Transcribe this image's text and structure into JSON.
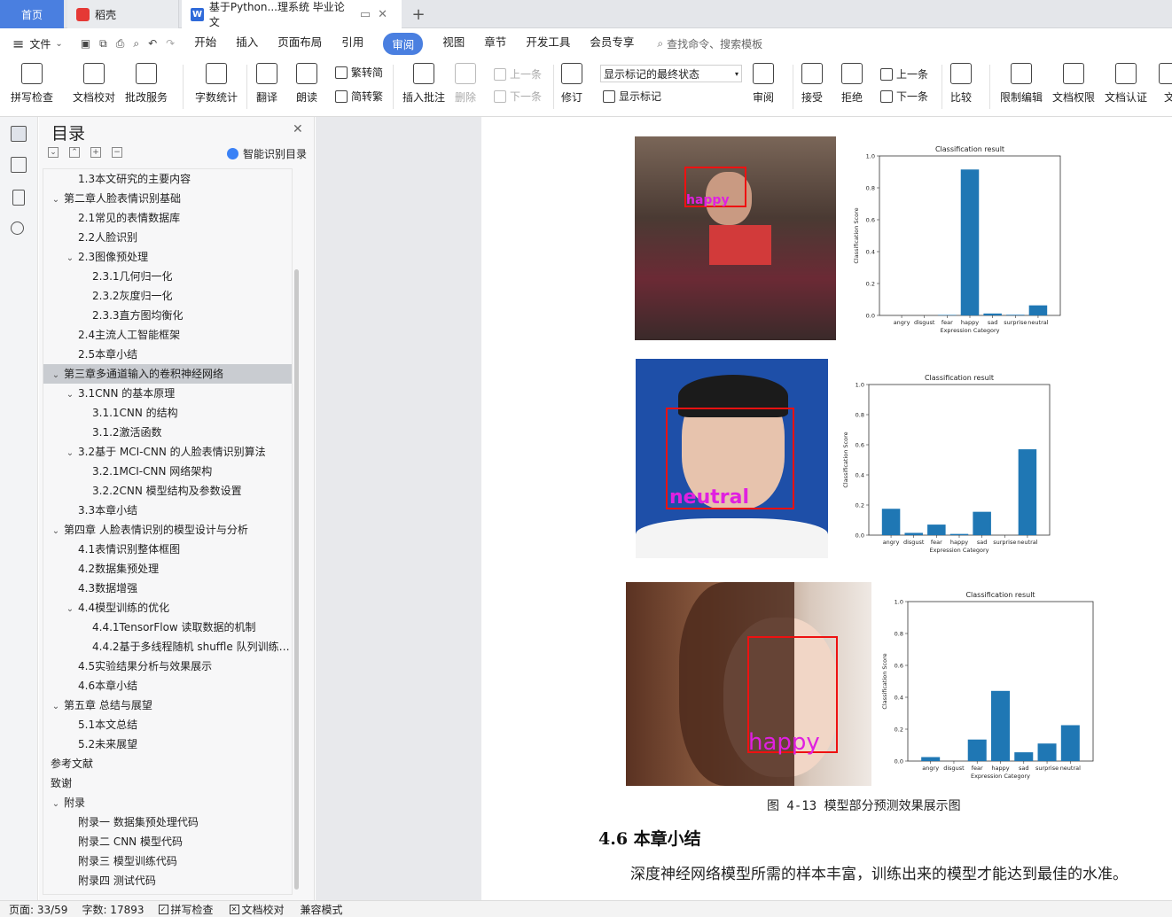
{
  "tabs": {
    "home": "首页",
    "daoke": "稻壳",
    "doc": "基于Python...理系统 毕业论文",
    "plus": "+"
  },
  "menubar": {
    "hamburger": "≡",
    "file": "文件",
    "items": [
      "开始",
      "插入",
      "页面布局",
      "引用",
      "审阅",
      "视图",
      "章节",
      "开发工具",
      "会员专享"
    ],
    "active": "审阅",
    "search": "查找命令、搜索模板"
  },
  "ribbon": {
    "spell": "拼写检查",
    "proof": "文档校对",
    "annot_service": "批改服务",
    "wordcount": "字数统计",
    "translate": "翻译",
    "read": "朗读",
    "to_trad": "简转繁",
    "to_simp": "繁转简",
    "insert_comment": "插入批注",
    "delete": "删除",
    "prev_c": "上一条",
    "next_c": "下一条",
    "revise": "修订",
    "markup_mode": "显示标记的最终状态",
    "show_markup": "显示标记",
    "review": "审阅",
    "accept": "接受",
    "reject": "拒绝",
    "prev": "上一条",
    "next": "下一条",
    "compare": "比较",
    "restrict": "限制编辑",
    "perm": "文档权限",
    "cert": "文档认证",
    "more": "文"
  },
  "toc": {
    "title": "目录",
    "smart": "智能识别目录",
    "items": [
      {
        "level": 2,
        "text": "1.3本文研究的主要内容"
      },
      {
        "level": 1,
        "text": "第二章人脸表情识别基础",
        "toggle": "⌄"
      },
      {
        "level": 2,
        "text": "2.1常见的表情数据库"
      },
      {
        "level": 2,
        "text": "2.2人脸识别"
      },
      {
        "level": 2,
        "text": "2.3图像预处理",
        "toggle": "⌄"
      },
      {
        "level": 3,
        "text": "2.3.1几何归一化"
      },
      {
        "level": 3,
        "text": "2.3.2灰度归一化"
      },
      {
        "level": 3,
        "text": "2.3.3直方图均衡化"
      },
      {
        "level": 2,
        "text": "2.4主流人工智能框架"
      },
      {
        "level": 2,
        "text": "2.5本章小结"
      },
      {
        "level": 1,
        "text": "第三章多通道输入的卷积神经网络",
        "toggle": "⌄",
        "selected": true
      },
      {
        "level": 2,
        "text": "3.1CNN 的基本原理",
        "toggle": "⌄"
      },
      {
        "level": 3,
        "text": "3.1.1CNN 的结构"
      },
      {
        "level": 3,
        "text": "3.1.2激活函数"
      },
      {
        "level": 2,
        "text": "3.2基于 MCI-CNN 的人脸表情识别算法",
        "toggle": "⌄"
      },
      {
        "level": 3,
        "text": "3.2.1MCI-CNN 网络架构"
      },
      {
        "level": 3,
        "text": "3.2.2CNN 模型结构及参数设置"
      },
      {
        "level": 2,
        "text": "3.3本章小结"
      },
      {
        "level": 1,
        "text": "第四章  人脸表情识别的模型设计与分析",
        "toggle": "⌄"
      },
      {
        "level": 2,
        "text": "4.1表情识别整体框图"
      },
      {
        "level": 2,
        "text": "4.2数据集预处理"
      },
      {
        "level": 2,
        "text": "4.3数据增强"
      },
      {
        "level": 2,
        "text": "4.4模型训练的优化",
        "toggle": "⌄"
      },
      {
        "level": 3,
        "text": "4.4.1TensorFlow 读取数据的机制"
      },
      {
        "level": 3,
        "text": "4.4.2基于多线程随机 shuffle 队列训练…"
      },
      {
        "level": 2,
        "text": "4.5实验结果分析与效果展示"
      },
      {
        "level": 2,
        "text": "4.6本章小结"
      },
      {
        "level": 1,
        "text": "第五章  总结与展望",
        "toggle": "⌄"
      },
      {
        "level": 2,
        "text": "5.1本文总结"
      },
      {
        "level": 2,
        "text": "5.2未来展望"
      },
      {
        "level": 1,
        "text": "参考文献"
      },
      {
        "level": 1,
        "text": "致谢"
      },
      {
        "level": 1,
        "text": "附录",
        "toggle": "⌄"
      },
      {
        "level": 2,
        "text": "附录一  数据集预处理代码"
      },
      {
        "level": 2,
        "text": "附录二  CNN 模型代码"
      },
      {
        "level": 2,
        "text": "附录三  模型训练代码"
      },
      {
        "level": 2,
        "text": "附录四  测试代码"
      }
    ]
  },
  "document": {
    "photo_labels": [
      "happy",
      "neutral",
      "happy"
    ],
    "caption": "图 4-13 模型部分预测效果展示图",
    "heading": "4.6 本章小结",
    "paragraph": "深度神经网络模型所需的样本丰富，训练出来的模型才能达到最佳的水准。"
  },
  "chart_data": [
    {
      "type": "bar",
      "title": "Classification result",
      "xlabel": "Expression Category",
      "ylabel": "Classification Score",
      "categories": [
        "angry",
        "disgust",
        "fear",
        "happy",
        "sad",
        "surprise",
        "neutral"
      ],
      "values": [
        0.0,
        0.0,
        0.003,
        0.915,
        0.012,
        0.004,
        0.063
      ],
      "ylim": [
        0,
        1.0
      ],
      "yticks": [
        "0.0",
        "0.2",
        "0.4",
        "0.6",
        "0.8",
        "1.0"
      ],
      "color": "#1f77b4"
    },
    {
      "type": "bar",
      "title": "Classification result",
      "xlabel": "Expression Category",
      "ylabel": "Classification Score",
      "categories": [
        "angry",
        "disgust",
        "fear",
        "happy",
        "sad",
        "surprise",
        "neutral"
      ],
      "values": [
        0.175,
        0.015,
        0.07,
        0.008,
        0.155,
        0.0,
        0.57
      ],
      "ylim": [
        0,
        1.0
      ],
      "yticks": [
        "0.0",
        "0.2",
        "0.4",
        "0.6",
        "0.8",
        "1.0"
      ],
      "color": "#1f77b4"
    },
    {
      "type": "bar",
      "title": "Classification result",
      "xlabel": "Expression Category",
      "ylabel": "Classification Score",
      "categories": [
        "angry",
        "disgust",
        "fear",
        "happy",
        "sad",
        "surprise",
        "neutral"
      ],
      "values": [
        0.025,
        0.0,
        0.135,
        0.44,
        0.055,
        0.11,
        0.225
      ],
      "ylim": [
        0,
        1.0
      ],
      "yticks": [
        "0.0",
        "0.2",
        "0.4",
        "0.6",
        "0.8",
        "1.0"
      ],
      "color": "#1f77b4"
    }
  ],
  "status": {
    "page": "页面: 33/59",
    "words": "字数: 17893",
    "spell": "拼写检查",
    "proof": "文档校对",
    "compat": "兼容模式"
  }
}
